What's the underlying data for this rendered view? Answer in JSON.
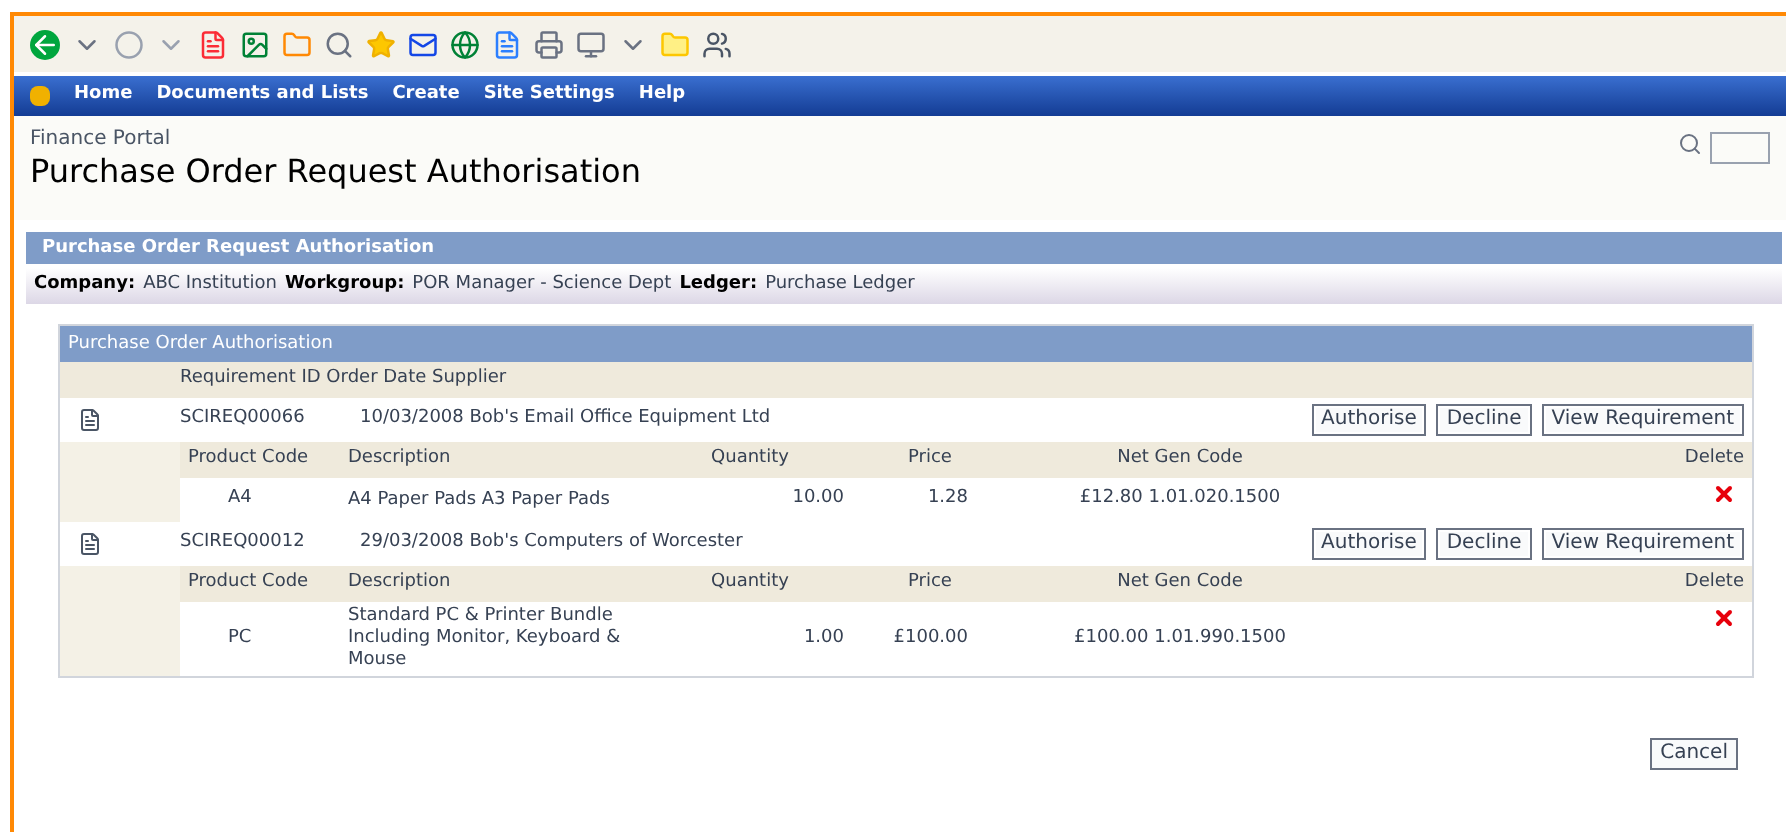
{
  "menu": [
    "Home",
    "Documents and Lists",
    "Create",
    "Site Settings",
    "Help"
  ],
  "header": {
    "portal": "Finance Portal",
    "title": "Purchase Order Request Authorisation"
  },
  "section_title": "Purchase Order Request Authorisation",
  "info": [
    {
      "label": "Company:",
      "value": "ABC Institution"
    },
    {
      "label": "Workgroup:",
      "value": "POR Manager - Science Dept"
    },
    {
      "label": "Ledger:",
      "value": "Purchase Ledger"
    }
  ],
  "panel": {
    "title": "Purchase Order Authorisation",
    "columns": "Requirement ID Order Date Supplier",
    "requirements": [
      {
        "id": "SCIREQ00066",
        "details": "10/03/2008 Bob's Email Office Equipment Ltd",
        "buttons": [
          "Authorise",
          "Decline",
          "View Requirement"
        ],
        "item_columns": [
          "Product Code",
          "Description",
          "Quantity",
          "Price",
          "Net Gen Code",
          "Delete"
        ],
        "items": [
          {
            "code": "A4",
            "description": "A4 Paper Pads A3 Paper Pads",
            "quantity": "10.00",
            "price": "1.28",
            "net_gen_code": "£12.80 1.01.020.1500"
          }
        ]
      },
      {
        "id": "SCIREQ00012",
        "details": "29/03/2008 Bob's Computers of Worcester",
        "buttons": [
          "Authorise",
          "Decline",
          "View Requirement"
        ],
        "item_columns": [
          "Product Code",
          "Description",
          "Quantity",
          "Price",
          "Net Gen Code",
          "Delete"
        ],
        "items": [
          {
            "code": "PC",
            "description": "Standard PC & Printer Bundle Including Monitor, Keyboard & Mouse",
            "quantity": "1.00",
            "price": "£100.00",
            "net_gen_code": "£100.00 1.01.990.1500"
          }
        ]
      }
    ]
  },
  "cancel": "Cancel"
}
